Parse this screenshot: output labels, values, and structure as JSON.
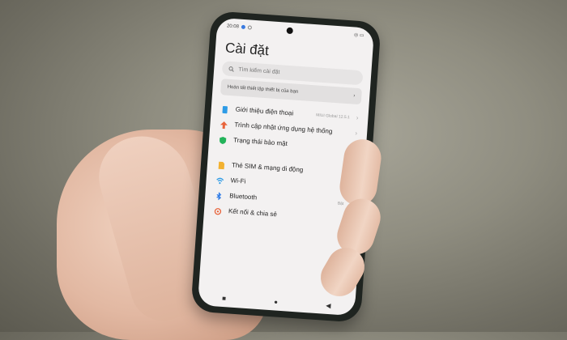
{
  "status_bar": {
    "time": "20:08",
    "right": "◎ ▭"
  },
  "settings": {
    "title": "Cài đặt",
    "search_placeholder": "Tìm kiếm cài đặt",
    "banner": "Hoàn tất thiết lập thiết bị của bạn",
    "items": [
      {
        "label": "Giới thiệu điện thoại",
        "value": "MIUI Global 12.5.1",
        "icon": "phone-info-icon",
        "color": "#2e9be6"
      },
      {
        "label": "Trình cập nhật ứng dụng hệ thống",
        "value": "",
        "icon": "update-arrow-icon",
        "color": "#e8643b"
      },
      {
        "label": "Trạng thái bảo mật",
        "value": "",
        "icon": "shield-icon",
        "color": "#23b35a"
      },
      {
        "label": "Thẻ SIM & mạng di động",
        "value": "",
        "icon": "sim-card-icon",
        "color": "#f2b130"
      },
      {
        "label": "Wi-Fi",
        "value": "",
        "icon": "wifi-icon",
        "color": "#2e9be6"
      },
      {
        "label": "Bluetooth",
        "value": "Bật",
        "icon": "bluetooth-icon",
        "color": "#2e7be6"
      },
      {
        "label": "Kết nối & chia sẻ",
        "value": "",
        "icon": "connection-icon",
        "color": "#e8643b"
      }
    ]
  },
  "nav_bar": {
    "recents": "■",
    "home": "●",
    "back": "◀"
  }
}
